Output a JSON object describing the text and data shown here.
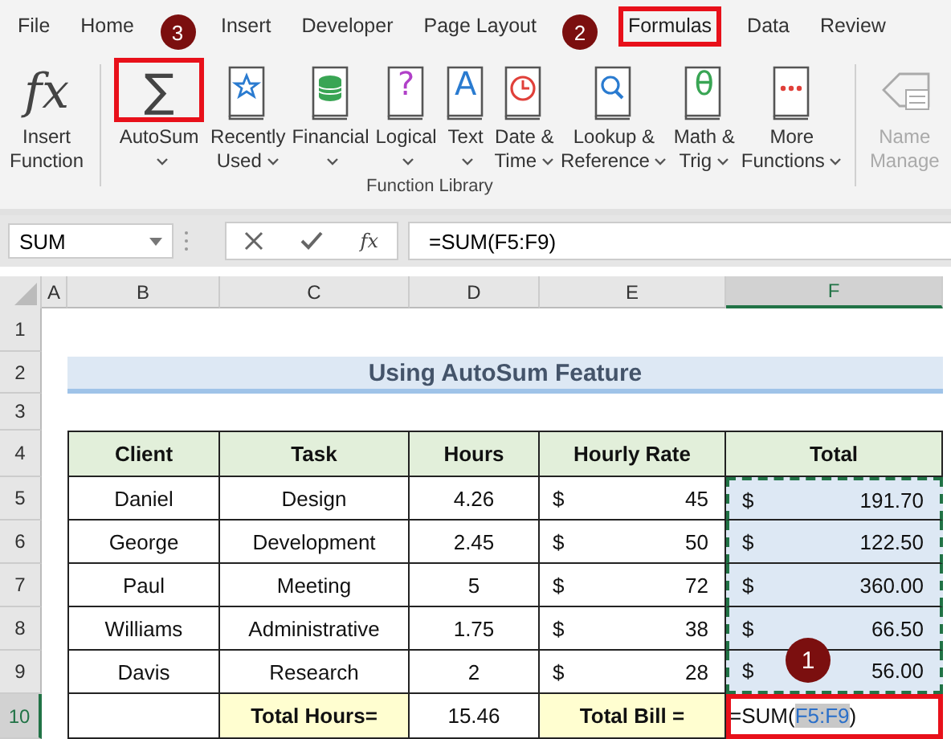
{
  "ribbon": {
    "tabs": [
      {
        "label": "File",
        "selected": false
      },
      {
        "label": "Home",
        "selected": false
      },
      {
        "label": "Insert",
        "selected": false
      },
      {
        "label": "Developer",
        "selected": false
      },
      {
        "label": "Page Layout",
        "selected": false
      },
      {
        "label": "Formulas",
        "selected": true,
        "callout": "2"
      },
      {
        "label": "Data",
        "selected": false
      },
      {
        "label": "Review",
        "selected": false
      }
    ],
    "buttons": [
      {
        "lines": [
          "Insert",
          "Function"
        ],
        "symbol": "fx",
        "dropdown": false,
        "disabled": false
      },
      {
        "lines": [
          "AutoSum"
        ],
        "symbol": "∑",
        "dropdown": true,
        "disabled": false,
        "callout": "3"
      },
      {
        "lines": [
          "Recently",
          "Used"
        ],
        "dropdown": true,
        "disabled": false
      },
      {
        "lines": [
          "Financial"
        ],
        "dropdown": true,
        "disabled": false
      },
      {
        "lines": [
          "Logical"
        ],
        "symbol": "?",
        "dropdown": true,
        "disabled": false
      },
      {
        "lines": [
          "Text"
        ],
        "symbol": "A",
        "dropdown": true,
        "disabled": false
      },
      {
        "lines": [
          "Date &",
          "Time"
        ],
        "dropdown": true,
        "disabled": false
      },
      {
        "lines": [
          "Lookup &",
          "Reference"
        ],
        "dropdown": true,
        "disabled": false
      },
      {
        "lines": [
          "Math &",
          "Trig"
        ],
        "symbol": "θ",
        "dropdown": true,
        "disabled": false
      },
      {
        "lines": [
          "More",
          "Functions"
        ],
        "dropdown": true,
        "disabled": false
      },
      {
        "lines": [
          "Name",
          "Manage"
        ],
        "dropdown": false,
        "disabled": true
      }
    ],
    "group_label": "Function Library"
  },
  "formula_bar": {
    "name_box": "SUM",
    "function_symbol": "fx",
    "formula": "=SUM(F5:F9)"
  },
  "sheet": {
    "columns": [
      {
        "label": "A",
        "selected": false
      },
      {
        "label": "B",
        "selected": false
      },
      {
        "label": "C",
        "selected": false
      },
      {
        "label": "D",
        "selected": false
      },
      {
        "label": "E",
        "selected": false
      },
      {
        "label": "F",
        "selected": true
      }
    ],
    "rows": [
      {
        "label": "1",
        "selected": false
      },
      {
        "label": "2",
        "selected": false
      },
      {
        "label": "3",
        "selected": false
      },
      {
        "label": "4",
        "selected": false
      },
      {
        "label": "5",
        "selected": false
      },
      {
        "label": "6",
        "selected": false
      },
      {
        "label": "7",
        "selected": false
      },
      {
        "label": "8",
        "selected": false
      },
      {
        "label": "9",
        "selected": false
      },
      {
        "label": "10",
        "selected": true
      }
    ],
    "title": "Using AutoSum Feature",
    "table": {
      "columns": [
        "Client",
        "Task",
        "Hours",
        "Hourly Rate",
        "Total"
      ],
      "rows": [
        {
          "client": "Daniel",
          "task": "Design",
          "hours": "4.26",
          "rate_currency": "$",
          "rate": "45",
          "total_currency": "$",
          "total": "191.70"
        },
        {
          "client": "George",
          "task": "Development",
          "hours": "2.45",
          "rate_currency": "$",
          "rate": "50",
          "total_currency": "$",
          "total": "122.50"
        },
        {
          "client": "Paul",
          "task": "Meeting",
          "hours": "5",
          "rate_currency": "$",
          "rate": "72",
          "total_currency": "$",
          "total": "360.00"
        },
        {
          "client": "Williams",
          "task": "Administrative",
          "hours": "1.75",
          "rate_currency": "$",
          "rate": "38",
          "total_currency": "$",
          "total": "66.50"
        },
        {
          "client": "Davis",
          "task": "Research",
          "hours": "2",
          "rate_currency": "$",
          "rate": "28",
          "total_currency": "$",
          "total": "56.00"
        }
      ],
      "total_column_referenced": true
    },
    "totals": {
      "hours_label": "Total Hours=",
      "hours": "15.46",
      "bill_label": "Total Bill =",
      "bill_editing": {
        "prefix": "=SUM(",
        "reference": "F5:F9",
        "suffix": ")"
      },
      "callout": "1"
    }
  }
}
